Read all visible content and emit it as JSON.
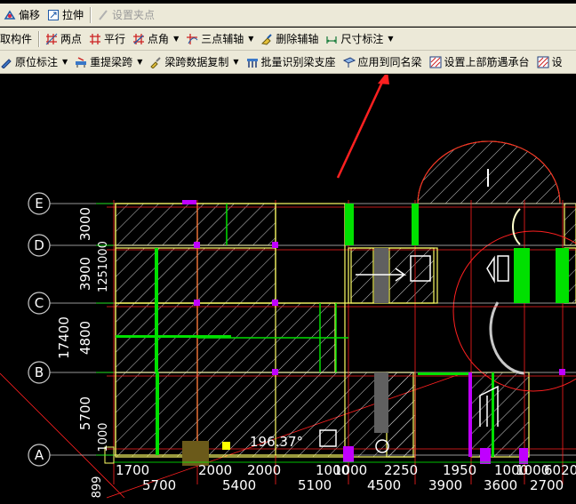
{
  "toolbar_row1": {
    "offset": "偏移",
    "stretch": "拉伸",
    "set_grip": "设置夹点"
  },
  "toolbar_row2": {
    "pick_member": "取构件",
    "two_point": "两点",
    "parallel": "平行",
    "point_angle": "点角",
    "three_point_aux": "三点辅轴",
    "delete_aux": "删除辅轴",
    "dimension": "尺寸标注"
  },
  "toolbar_row3": {
    "in_situ_label": "原位标注",
    "re_pick_span": "重提梁跨",
    "copy_span_data": "梁跨数据复制",
    "batch_identify_support": "批量识别梁支座",
    "apply_same_name": "应用到同名梁",
    "set_top_bar": "设置上部筋遇承台",
    "set_more": "设"
  },
  "drawing": {
    "axis_labels": [
      "E",
      "D",
      "C",
      "B",
      "A"
    ],
    "left_dims": [
      "3000",
      "3900",
      "4800",
      "5700"
    ],
    "left_total": "17400",
    "left_extra": [
      "1251000",
      "1000",
      "899"
    ],
    "angle_label": "196.37°",
    "bottom_row1": [
      "1700",
      "2000",
      "2000",
      "1000",
      "1000",
      "2250",
      "1950",
      "1000",
      "1000",
      "6020"
    ],
    "bottom_row2": [
      "5700",
      "5400",
      "5100",
      "4500",
      "3900",
      "3600",
      "2700"
    ]
  },
  "colors": {
    "grid": "#c8c8c8",
    "beam": "#ffff66",
    "beam_green": "#00ff00",
    "red_line": "#ff2020",
    "magenta": "#b000ff",
    "hatch": "#ffffff",
    "toolbar_bg": "#ece9d8"
  }
}
